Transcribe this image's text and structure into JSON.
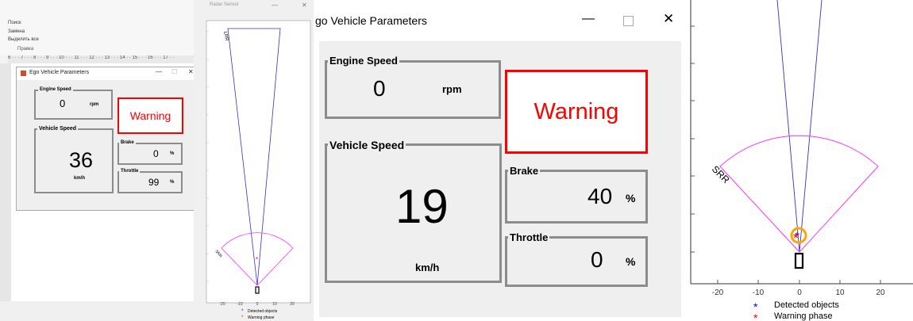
{
  "left_panel": {
    "toolbar": {
      "items": [
        "Поиск",
        "Замена",
        "Выделить все"
      ],
      "section_label": "Правка",
      "ruler_text": "6 · · · 7 · · · 8 · · · 9 · · · 10 · · · 11 · · · 12 · · · 13 · · · 14 · · 15 · · · 16 · · · 17 · ·"
    },
    "window": {
      "title": "Ego Vehicle Parameters",
      "engine": {
        "title": "Engine Speed",
        "value": "0",
        "unit": "rpm"
      },
      "vehicle": {
        "title": "Vehicle Speed",
        "value": "36",
        "unit": "km/h"
      },
      "warning": "Warning",
      "brake": {
        "title": "Brake",
        "value": "0",
        "unit": "%"
      },
      "throttle": {
        "title": "Throttle",
        "value": "99",
        "unit": "%"
      }
    }
  },
  "mid_plot": {
    "title": "Radar Sensor",
    "lrr_label": "LRR",
    "srr_label": "SRR",
    "x_ticks": [
      "-20",
      "-10",
      "0",
      "10",
      "20"
    ],
    "legend": [
      "Detected objects",
      "Warning phase"
    ]
  },
  "main_window": {
    "title": "go Vehicle Parameters",
    "engine": {
      "title": "Engine Speed",
      "value": "0",
      "unit": "rpm"
    },
    "vehicle": {
      "title": "Vehicle Speed",
      "value": "19",
      "unit": "km/h"
    },
    "warning": "Warning",
    "brake": {
      "title": "Brake",
      "value": "40",
      "unit": "%"
    },
    "throttle": {
      "title": "Throttle",
      "value": "0",
      "unit": "%"
    }
  },
  "right_plot": {
    "srr_label": "SRR",
    "x_ticks": [
      "-20",
      "-10",
      "0",
      "10",
      "20"
    ],
    "legend": [
      "Detected objects",
      "Warning phase"
    ],
    "colors": {
      "detected": "#0000ff",
      "warning": "#ff0000",
      "sector": "#ff00ff",
      "highlight": "#ffa500"
    }
  }
}
